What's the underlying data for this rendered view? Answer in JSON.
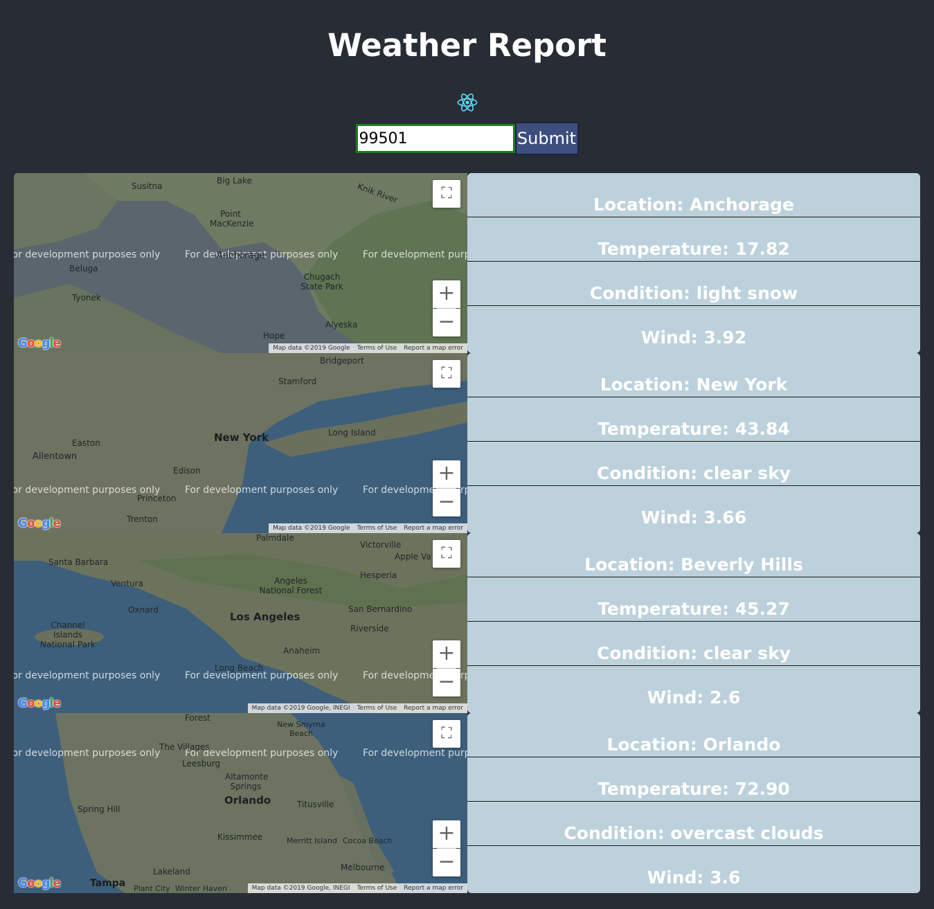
{
  "header": {
    "title": "Weather Report",
    "logo_icon": "react-atom-icon"
  },
  "form": {
    "zip_value": "99501",
    "submit_label": "Submit"
  },
  "map_common": {
    "dev_text": "For development purposes only",
    "terms": "Terms of Use",
    "report": "Report a map error",
    "logo": [
      "G",
      "o",
      "o",
      "g",
      "l",
      "e"
    ]
  },
  "reports": [
    {
      "map": {
        "attribution": "Map data ©2019 Google",
        "labels": [
          "Susitna",
          "Big Lake",
          "Knik River",
          "Point MacKenzie",
          "Anchorage",
          "Beluga",
          "Chugach State Park",
          "Tyonek",
          "Alyeska",
          "Hope"
        ],
        "land_color": "#6f7a63",
        "water_color": "#51606b"
      },
      "location": "Location: Anchorage",
      "temperature": "Temperature: 17.82",
      "condition": "Condition: light snow",
      "wind": "Wind: 3.92"
    },
    {
      "map": {
        "attribution": "Map data ©2019 Google",
        "labels": [
          "Bridgeport",
          "Stamford",
          "New York",
          "Long Island",
          "Easton",
          "Allentown",
          "Edison",
          "Princeton",
          "Trenton"
        ],
        "land_color": "#6e7260",
        "water_color": "#3d5f7c"
      },
      "location": "Location: New York",
      "temperature": "Temperature: 43.84",
      "condition": "Condition: clear sky",
      "wind": "Wind: 3.66"
    },
    {
      "map": {
        "attribution": "Map data ©2019 Google, INEGI",
        "labels": [
          "Palmdale",
          "Victorville",
          "Apple Va",
          "Santa Barbara",
          "Hesperia",
          "Ventura",
          "Angeles National Forest",
          "Oxnard",
          "Los Angeles",
          "San Bernardino",
          "Riverside",
          "Channel Islands National Park",
          "Anaheim",
          "Long Beach"
        ],
        "land_color": "#6c735c",
        "water_color": "#3d5f7c"
      },
      "location": "Location: Beverly Hills",
      "temperature": "Temperature: 45.27",
      "condition": "Condition: clear sky",
      "wind": "Wind: 2.6"
    },
    {
      "map": {
        "attribution": "Map data ©2019 Google, INEGI",
        "labels": [
          "Forest",
          "New Smyrna Beach",
          "The Villages",
          "Leesburg",
          "Altamonte Springs",
          "Orlando",
          "Titusville",
          "Spring Hill",
          "Kissimmee",
          "Merritt Island",
          "Cocoa Beach",
          "Melbourne",
          "Lakeland",
          "Tampa",
          "Plant City",
          "Winter Haven"
        ],
        "land_color": "#6c7360",
        "water_color": "#3d5f7c"
      },
      "location": "Location: Orlando",
      "temperature": "Temperature: 72.90",
      "condition": "Condition: overcast clouds",
      "wind": "Wind: 3.6"
    }
  ]
}
